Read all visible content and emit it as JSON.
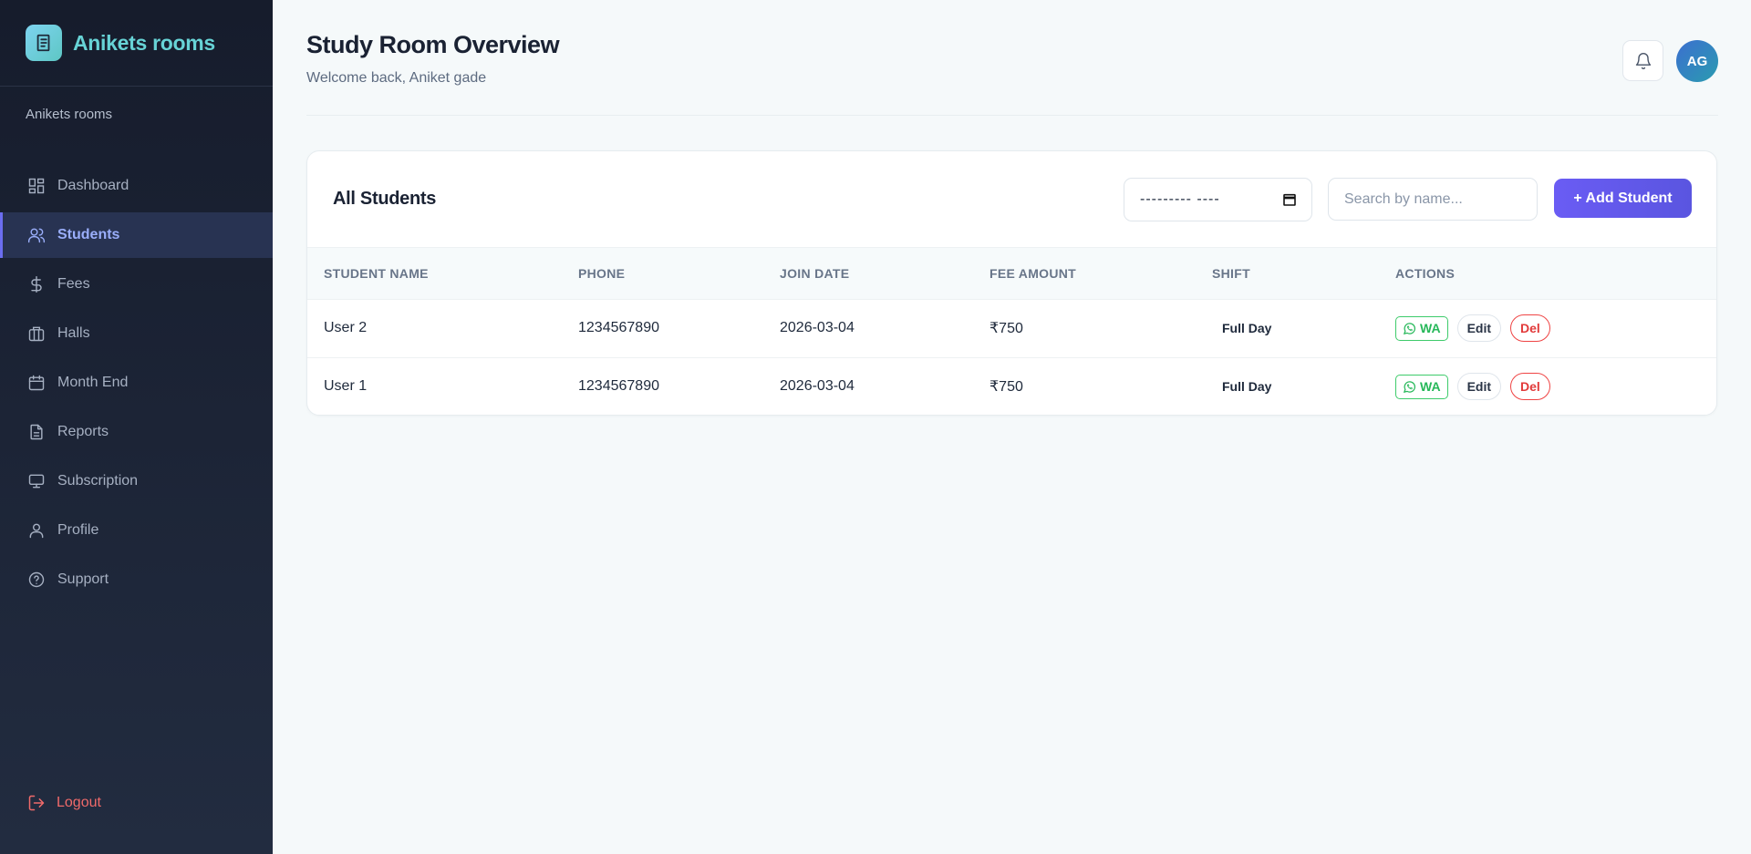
{
  "brand": {
    "title": "Anikets rooms",
    "org_name": "Anikets rooms"
  },
  "sidebar": {
    "items": [
      {
        "label": "Dashboard",
        "icon": "dashboard-icon",
        "active": false
      },
      {
        "label": "Students",
        "icon": "users-icon",
        "active": true
      },
      {
        "label": "Fees",
        "icon": "dollar-icon",
        "active": false
      },
      {
        "label": "Halls",
        "icon": "building-icon",
        "active": false
      },
      {
        "label": "Month End",
        "icon": "calendar-icon",
        "active": false
      },
      {
        "label": "Reports",
        "icon": "file-icon",
        "active": false
      },
      {
        "label": "Subscription",
        "icon": "monitor-icon",
        "active": false
      },
      {
        "label": "Profile",
        "icon": "user-icon",
        "active": false
      },
      {
        "label": "Support",
        "icon": "help-icon",
        "active": false
      }
    ],
    "logout_label": "Logout"
  },
  "header": {
    "title": "Study Room Overview",
    "subtitle": "Welcome back, Aniket gade",
    "avatar_initials": "AG"
  },
  "students": {
    "title": "All Students",
    "date_value": "--------- ----",
    "search_placeholder": "Search by name...",
    "add_label": "+ Add Student",
    "columns": [
      "STUDENT NAME",
      "PHONE",
      "JOIN DATE",
      "FEE AMOUNT",
      "SHIFT",
      "ACTIONS"
    ],
    "rows": [
      {
        "name": "User 2",
        "phone": "1234567890",
        "join_date": "2026-03-04",
        "fee": "₹750",
        "shift": "Full Day"
      },
      {
        "name": "User 1",
        "phone": "1234567890",
        "join_date": "2026-03-04",
        "fee": "₹750",
        "shift": "Full Day"
      }
    ],
    "action_labels": {
      "wa": "WA",
      "edit": "Edit",
      "del": "Del"
    }
  },
  "colors": {
    "accent": "#6a5cf4",
    "sidebar_bg": "#1b2233",
    "brand": "#67d3d6",
    "danger": "#ef4444",
    "whatsapp": "#27b85a"
  }
}
